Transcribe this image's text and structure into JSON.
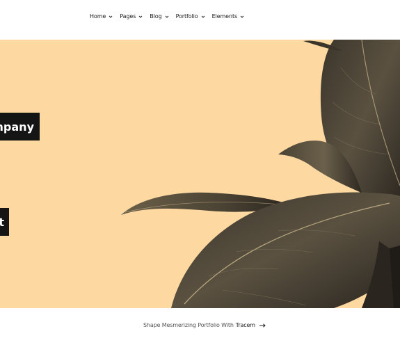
{
  "nav": {
    "items": [
      {
        "label": "Home"
      },
      {
        "label": "Pages"
      },
      {
        "label": "Blog"
      },
      {
        "label": "Portfolio"
      },
      {
        "label": "Elements"
      }
    ]
  },
  "hero": {
    "background_color": "#fdd8a0",
    "tag_1": "mpany",
    "tag_2": "t",
    "image": "rubber-plant-leaves"
  },
  "footer": {
    "text": "Shape Mesmerizing Portfolio With",
    "brand": "Tracem",
    "icon": "arrow-right-icon"
  }
}
